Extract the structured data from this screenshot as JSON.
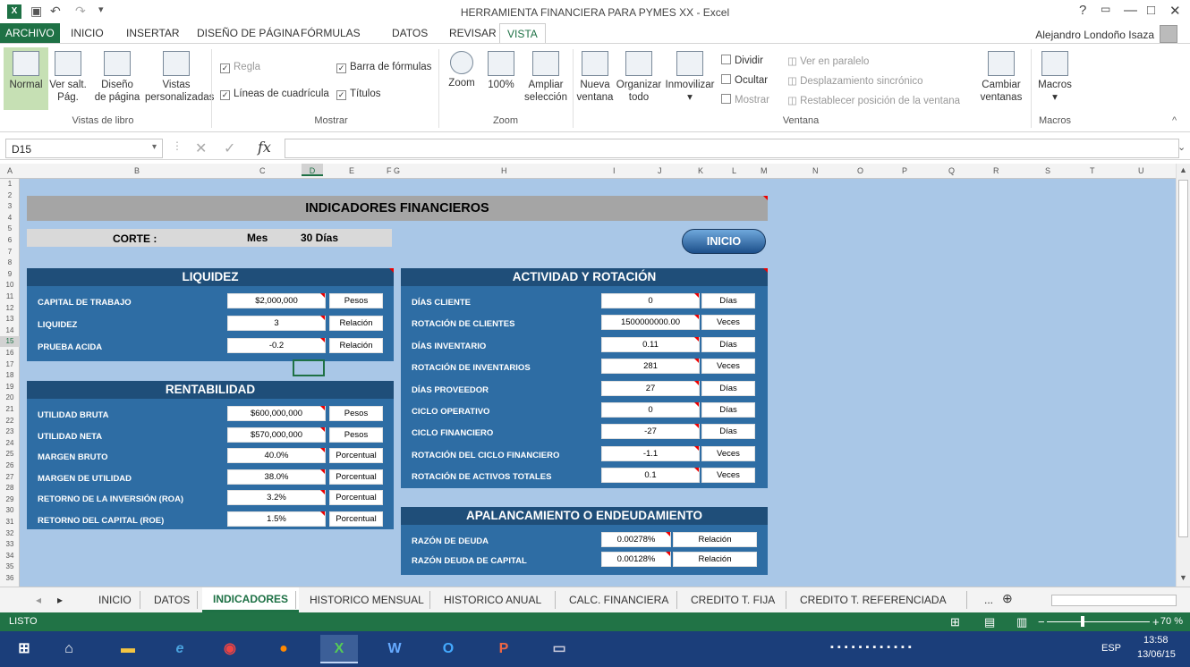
{
  "title_bar": {
    "app_icon": "X",
    "window_title": "HERRAMIENTA FINANCIERA PARA PYMES XX - Excel",
    "help": "?",
    "controls": [
      "—",
      "□",
      "✕"
    ]
  },
  "ribbon_tabs": [
    "ARCHIVO",
    "INICIO",
    "INSERTAR",
    "DISEÑO DE PÁGINA",
    "FÓRMULAS",
    "DATOS",
    "REVISAR",
    "VISTA"
  ],
  "active_ribbon_tab": "VISTA",
  "user": {
    "name": "Alejandro Londoño Isaza"
  },
  "ribbon": {
    "vistas_de_libro": {
      "label": "Vistas de libro",
      "normal": "Normal",
      "ver_salt_1": "Ver salt.",
      "ver_salt_2": "Pág.",
      "diseno_1": "Diseño",
      "diseno_2": "de página",
      "vistas_1": "Vistas",
      "vistas_2": "personalizadas"
    },
    "mostrar": {
      "label": "Mostrar",
      "regla": "Regla",
      "barra_formulas": "Barra de fórmulas",
      "lineas": "Líneas de cuadrícula",
      "titulos": "Títulos"
    },
    "zoom": {
      "label": "Zoom",
      "zoom": "Zoom",
      "cien": "100%",
      "ampliar_1": "Ampliar",
      "ampliar_2": "selección"
    },
    "ventana": {
      "label": "Ventana",
      "nueva_1": "Nueva",
      "nueva_2": "ventana",
      "organizar_1": "Organizar",
      "organizar_2": "todo",
      "inmovilizar": "Inmovilizar",
      "dividir": "Dividir",
      "ocultar": "Ocultar",
      "mostrar": "Mostrar",
      "paralelo": "Ver en paralelo",
      "sincronico": "Desplazamiento sincrónico",
      "restablecer": "Restablecer posición de la ventana",
      "cambiar_1": "Cambiar",
      "cambiar_2": "ventanas"
    },
    "macros": {
      "label": "Macros",
      "macros": "Macros"
    }
  },
  "formula_bar": {
    "name_box": "D15",
    "fx": "fx",
    "formula": ""
  },
  "columns": [
    "A",
    "B",
    "C",
    "D",
    "E",
    "F",
    "G",
    "H",
    "I",
    "J",
    "K",
    "L",
    "M",
    "N",
    "O",
    "P",
    "Q",
    "R",
    "S",
    "T",
    "U"
  ],
  "rows": [
    "1",
    "2",
    "3",
    "4",
    "5",
    "6",
    "7",
    "8",
    "9",
    "10",
    "11",
    "12",
    "13",
    "14",
    "15",
    "16",
    "17",
    "18",
    "19",
    "20",
    "21",
    "22",
    "23",
    "24",
    "25",
    "26",
    "27",
    "28",
    "29",
    "30",
    "31",
    "32",
    "33",
    "34",
    "35",
    "36"
  ],
  "sheet": {
    "title": "INDICADORES FINANCIEROS",
    "corte_label": "CORTE :",
    "mes": "Mes",
    "dias": "30 Días",
    "inicio_button": "INICIO",
    "liquidez": {
      "header": "LIQUIDEZ",
      "items": [
        {
          "label": "CAPITAL DE TRABAJO",
          "value": "$2,000,000",
          "unit": "Pesos"
        },
        {
          "label": "LIQUIDEZ",
          "value": "3",
          "unit": "Relación"
        },
        {
          "label": "PRUEBA ACIDA",
          "value": "-0.2",
          "unit": "Relación"
        }
      ]
    },
    "rentabilidad": {
      "header": "RENTABILIDAD",
      "items": [
        {
          "label": "UTILIDAD BRUTA",
          "value": "$600,000,000",
          "unit": "Pesos"
        },
        {
          "label": "UTILIDAD NETA",
          "value": "$570,000,000",
          "unit": "Pesos"
        },
        {
          "label": "MARGEN BRUTO",
          "value": "40.0%",
          "unit": "Porcentual"
        },
        {
          "label": "MARGEN DE UTILIDAD",
          "value": "38.0%",
          "unit": "Porcentual"
        },
        {
          "label": "RETORNO DE LA INVERSIÓN (ROA)",
          "value": "3.2%",
          "unit": "Porcentual"
        },
        {
          "label": "RETORNO DEL CAPITAL (ROE)",
          "value": "1.5%",
          "unit": "Porcentual"
        }
      ]
    },
    "actividad": {
      "header": "ACTIVIDAD Y ROTACIÓN",
      "items": [
        {
          "label": "DÍAS CLIENTE",
          "value": "0",
          "unit": "Días"
        },
        {
          "label": "ROTACIÓN DE CLIENTES",
          "value": "1500000000.00",
          "unit": "Veces"
        },
        {
          "label": "DÍAS INVENTARIO",
          "value": "0.11",
          "unit": "Días"
        },
        {
          "label": "ROTACIÓN DE INVENTARIOS",
          "value": "281",
          "unit": "Veces"
        },
        {
          "label": "DÍAS PROVEEDOR",
          "value": "27",
          "unit": "Días"
        },
        {
          "label": "CICLO OPERATIVO",
          "value": "0",
          "unit": "Días"
        },
        {
          "label": "CICLO FINANCIERO",
          "value": "-27",
          "unit": "Días"
        },
        {
          "label": "ROTACIÓN DEL CICLO FINANCIERO",
          "value": "-1.1",
          "unit": "Veces"
        },
        {
          "label": "ROTACIÓN DE ACTIVOS TOTALES",
          "value": "0.1",
          "unit": "Veces"
        }
      ]
    },
    "apalancamiento": {
      "header": "APALANCAMIENTO O ENDEUDAMIENTO",
      "items": [
        {
          "label": "RAZÓN DE DEUDA",
          "value": "0.00278%",
          "unit": "Relación"
        },
        {
          "label": "RAZÓN DEUDA DE CAPITAL",
          "value": "0.00128%",
          "unit": "Relación"
        }
      ]
    }
  },
  "sheet_tabs": [
    "INICIO",
    "DATOS",
    "INDICADORES",
    "HISTORICO MENSUAL",
    "HISTORICO ANUAL",
    "CALC. FINANCIERA",
    "CREDITO T. FIJA",
    "CREDITO T. REFERENCIADA"
  ],
  "active_sheet_tab": "INDICADORES",
  "more_tabs": "...",
  "status": {
    "text": "LISTO",
    "zoom": "70 %"
  },
  "taskbar": {
    "lang": "ESP",
    "time": "13:58",
    "date": "13/06/15"
  },
  "colors": {
    "excel_green": "#217346",
    "panel_blue": "#2e6da4",
    "panel_header": "#1f4e79",
    "sheet_bg": "#a9c7e7"
  }
}
